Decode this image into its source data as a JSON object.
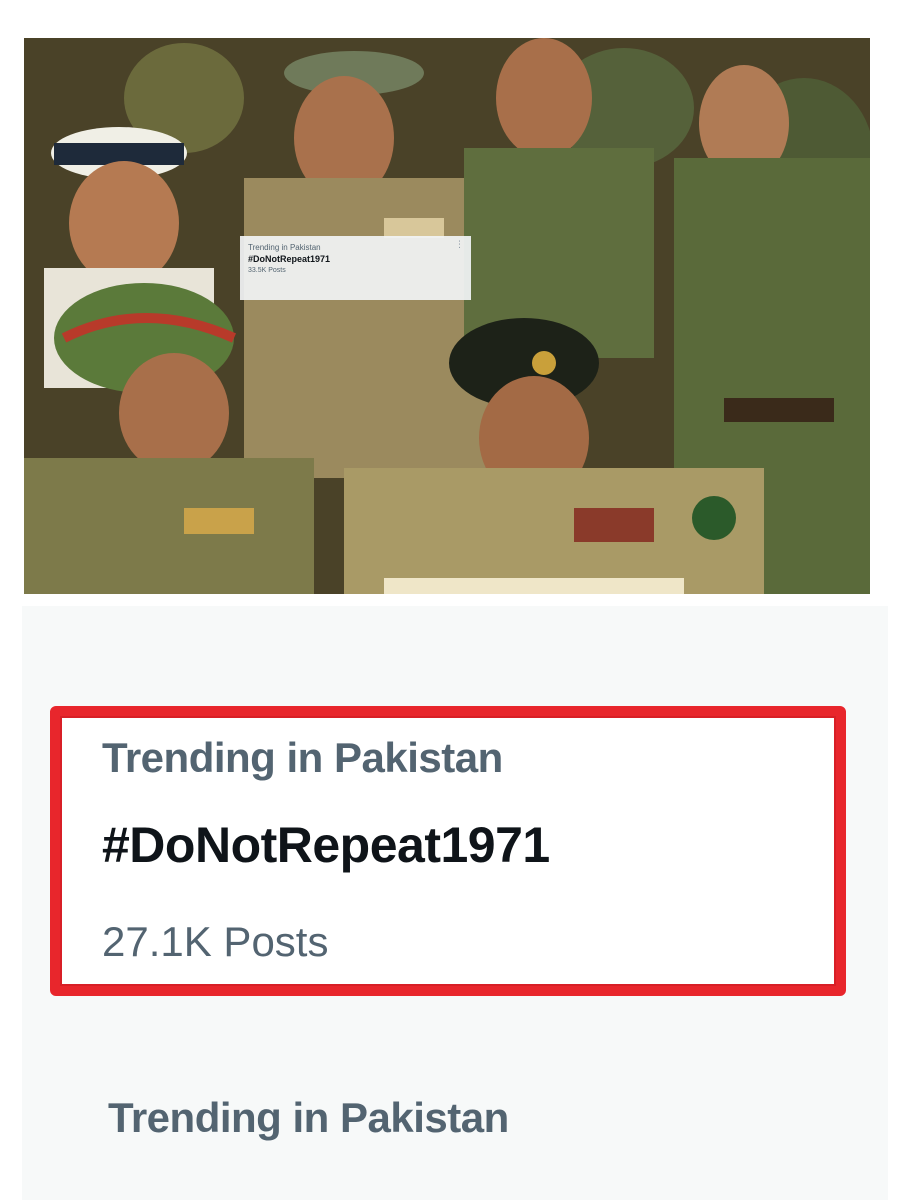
{
  "photo_overlay": {
    "label": "Trending in Pakistan",
    "hashtag": "#DoNotRepeat1971",
    "count": "33.5K Posts",
    "more_icon": "more-dots-icon"
  },
  "trend_item": {
    "label": "Trending in Pakistan",
    "hashtag": "#DoNotRepeat1971",
    "count": "27.1K Posts"
  },
  "next_trend": {
    "label": "Trending in Pakistan"
  },
  "colors": {
    "highlight_border": "#e8262c",
    "secondary_text": "#536471",
    "primary_text": "#0f1419"
  }
}
